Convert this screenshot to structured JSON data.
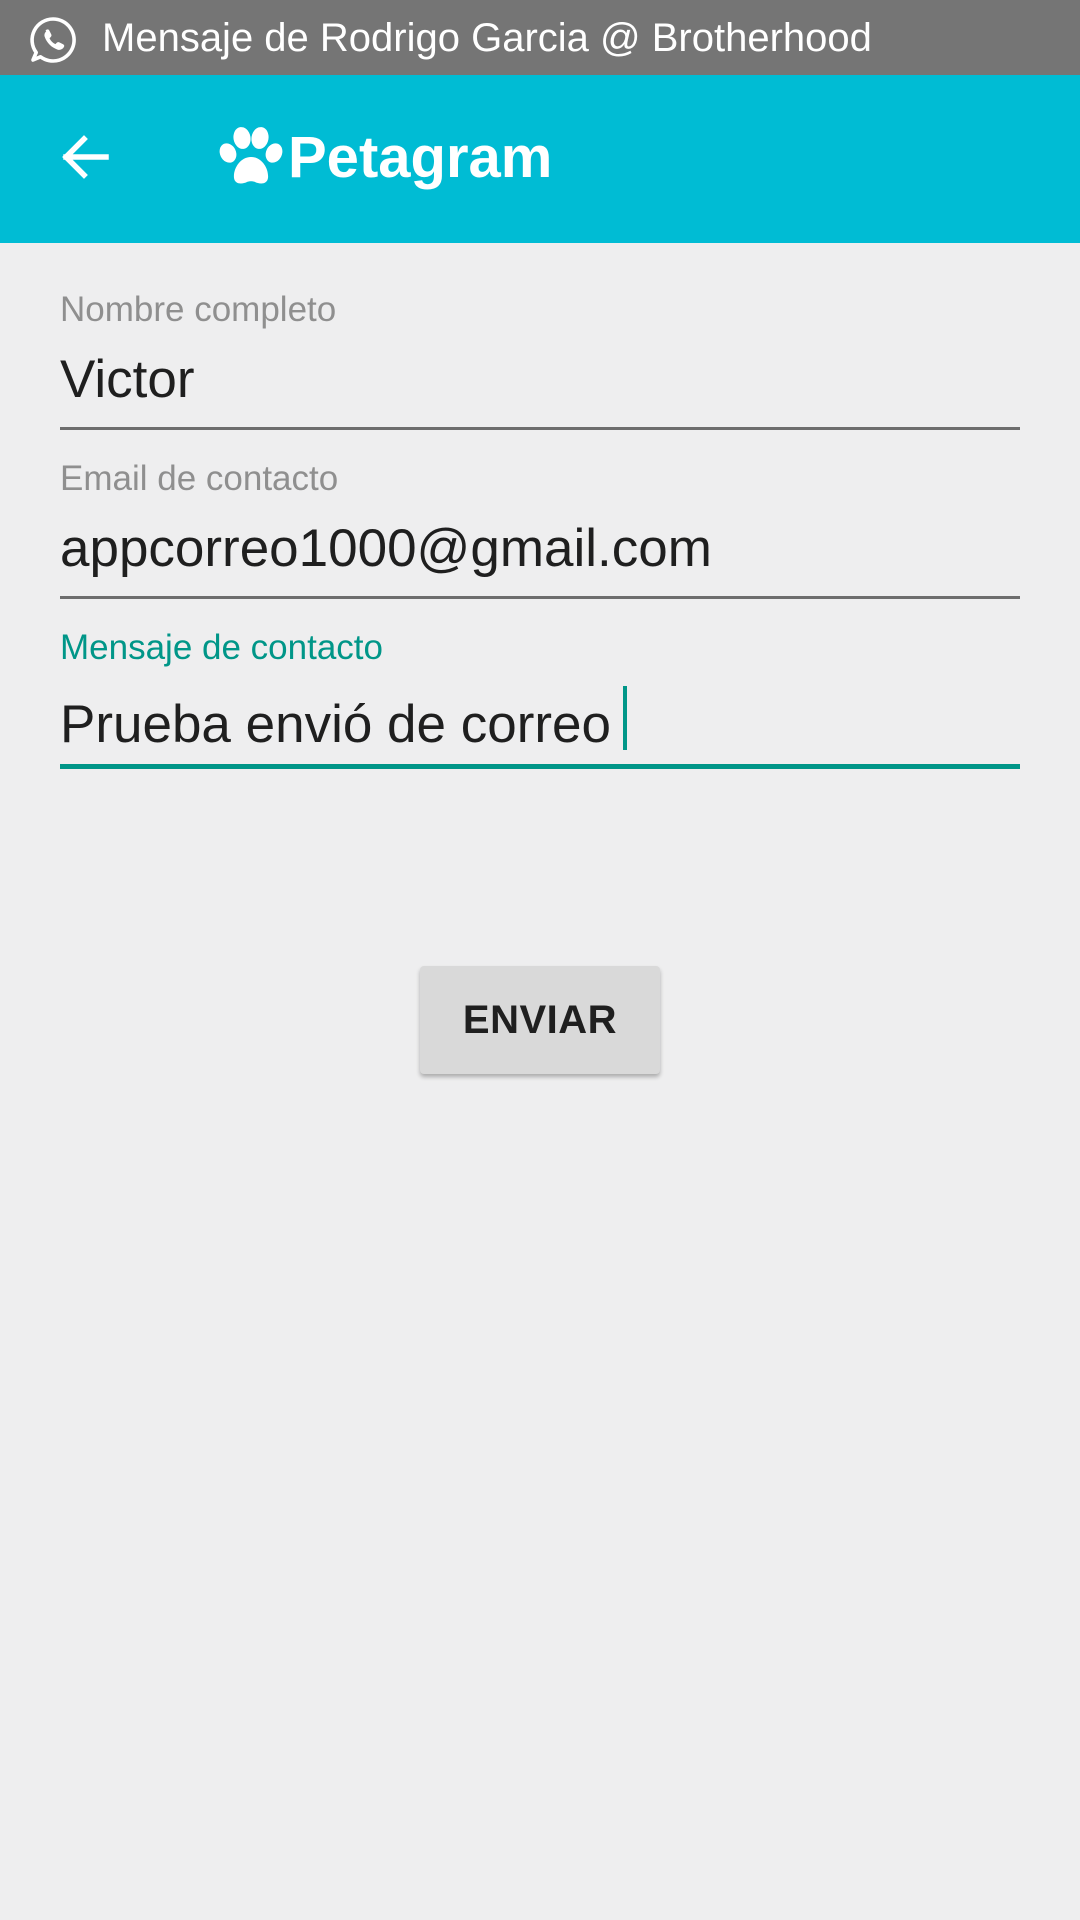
{
  "notification": {
    "icon": "whatsapp-icon",
    "text": "Mensaje de Rodrigo Garcia @ Brotherhood"
  },
  "toolbar": {
    "back_icon": "arrow-left-icon",
    "logo_icon": "paw-icon",
    "title": "Petagram",
    "background": "#00bcd4"
  },
  "form": {
    "name": {
      "label": "Nombre completo",
      "value": "Victor"
    },
    "email": {
      "label": "Email de contacto",
      "value": "appcorreo1000@gmail.com"
    },
    "message": {
      "label": "Mensaje de contacto",
      "value": "Prueba envió de correo",
      "focused": true
    },
    "accent_color": "#009688"
  },
  "send_button": {
    "label": "ENVIAR"
  }
}
